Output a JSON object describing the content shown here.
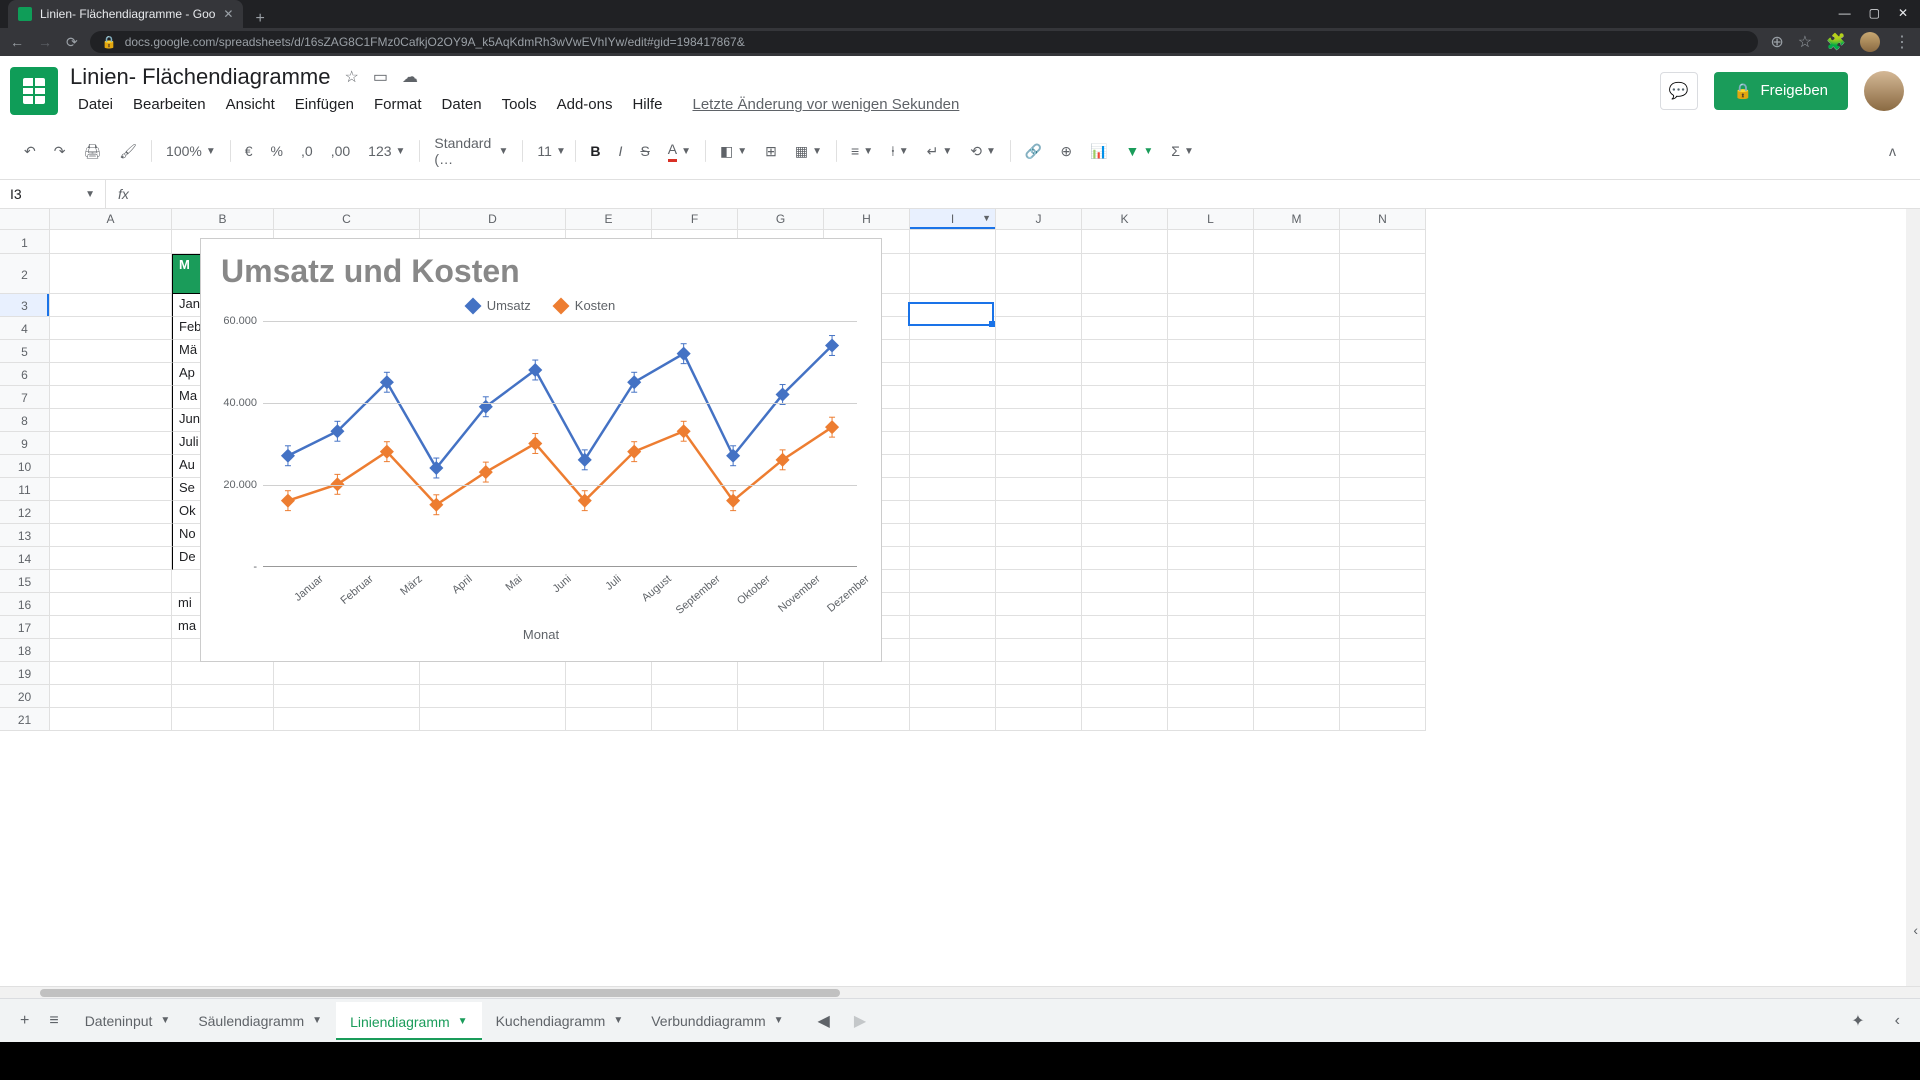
{
  "browser": {
    "tab_title": "Linien- Flächendiagramme - Goo",
    "url": "docs.google.com/spreadsheets/d/16sZAG8C1FMz0CafkjO2OY9A_k5AqKdmRh3wVwEVhIYw/edit#gid=198417867&"
  },
  "header": {
    "doc_title": "Linien- Flächendiagramme",
    "menu": {
      "file": "Datei",
      "edit": "Bearbeiten",
      "view": "Ansicht",
      "insert": "Einfügen",
      "format": "Format",
      "data": "Daten",
      "tools": "Tools",
      "addons": "Add-ons",
      "help": "Hilfe"
    },
    "last_edit": "Letzte Änderung vor wenigen Sekunden",
    "share": "Freigeben"
  },
  "toolbar": {
    "zoom": "100%",
    "currency": "€",
    "percent": "%",
    "dec_dec": ",0",
    "inc_dec": ",00",
    "num_format": "123",
    "font": "Standard (…",
    "font_size": "11",
    "bold": "B",
    "italic": "I",
    "strike": "S",
    "text_color": "A"
  },
  "namebox": {
    "ref": "I3",
    "fx": "fx"
  },
  "columns": [
    "A",
    "B",
    "C",
    "D",
    "E",
    "F",
    "G",
    "H",
    "I",
    "J",
    "K",
    "L",
    "M",
    "N"
  ],
  "rows_visible": 21,
  "table": {
    "header_col_b": "M",
    "months": [
      "Jan",
      "Feb",
      "Mä",
      "Ap",
      "Ma",
      "Jun",
      "Juli",
      "Au",
      "Se",
      "Ok",
      "No",
      "De"
    ],
    "extra": [
      "mi",
      "ma"
    ]
  },
  "chart_data": {
    "type": "line",
    "title": "Umsatz und Kosten",
    "xlabel": "Monat",
    "ylabel": "",
    "ylim": [
      0,
      60000
    ],
    "yticks": [
      "60.000",
      "40.000",
      "20.000",
      "-"
    ],
    "categories": [
      "Januar",
      "Februar",
      "März",
      "April",
      "Mai",
      "Juni",
      "Juli",
      "August",
      "September",
      "Oktober",
      "November",
      "Dezember"
    ],
    "series": [
      {
        "name": "Umsatz",
        "color": "#4472c4",
        "values": [
          27000,
          33000,
          45000,
          24000,
          39000,
          48000,
          26000,
          45000,
          52000,
          27000,
          42000,
          54000
        ]
      },
      {
        "name": "Kosten",
        "color": "#ed7d31",
        "values": [
          16000,
          20000,
          28000,
          15000,
          23000,
          30000,
          16000,
          28000,
          33000,
          16000,
          26000,
          34000
        ]
      }
    ]
  },
  "sheet_tabs": {
    "add": "+",
    "all": "≡",
    "tabs": [
      {
        "label": "Dateninput",
        "active": false
      },
      {
        "label": "Säulendiagramm",
        "active": false
      },
      {
        "label": "Liniendiagramm",
        "active": true
      },
      {
        "label": "Kuchendiagramm",
        "active": false
      },
      {
        "label": "Verbunddiagramm",
        "active": false
      }
    ]
  }
}
